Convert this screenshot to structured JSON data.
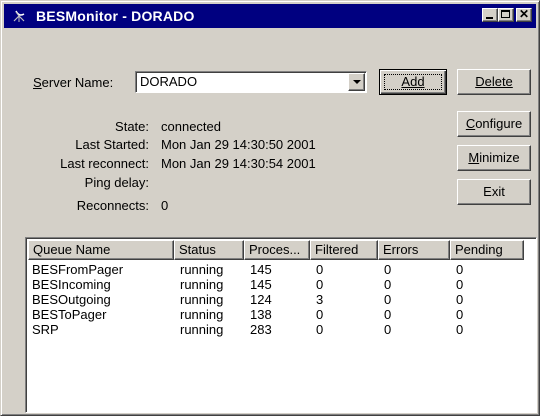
{
  "window": {
    "title": "BESMonitor - DORADO"
  },
  "server": {
    "label": "Server Name:",
    "value": "DORADO"
  },
  "buttons": {
    "add": "Add",
    "delete": "Delete",
    "configure": "Configure",
    "minimize": "Minimize",
    "exit": "Exit"
  },
  "status": {
    "state_label": "State:",
    "state_value": "connected",
    "last_started_label": "Last Started:",
    "last_started_value": "Mon Jan 29 14:30:50 2001",
    "last_reconnect_label": "Last reconnect:",
    "last_reconnect_value": "Mon Jan 29 14:30:54 2001",
    "ping_delay_label": "Ping delay:",
    "ping_delay_value": "",
    "reconnects_label": "Reconnects:",
    "reconnects_value": "0"
  },
  "queue_table": {
    "columns": [
      "Queue Name",
      "Status",
      "Proces...",
      "Filtered",
      "Errors",
      "Pending"
    ],
    "rows": [
      [
        "BESFromPager",
        "running",
        "145",
        "0",
        "0",
        "0"
      ],
      [
        "BESIncoming",
        "running",
        "145",
        "0",
        "0",
        "0"
      ],
      [
        "BESOutgoing",
        "running",
        "124",
        "3",
        "0",
        "0"
      ],
      [
        "BESToPager",
        "running",
        "138",
        "0",
        "0",
        "0"
      ],
      [
        "SRP",
        "running",
        "283",
        "0",
        "0",
        "0"
      ]
    ]
  },
  "colors": {
    "titlebar": "#000080",
    "face": "#d4d0c8"
  },
  "icons": {
    "app": "satellite-dish-icon",
    "minimize": "minimize-icon",
    "maximize": "maximize-icon",
    "close": "close-icon",
    "dropdown": "chevron-down-icon"
  }
}
